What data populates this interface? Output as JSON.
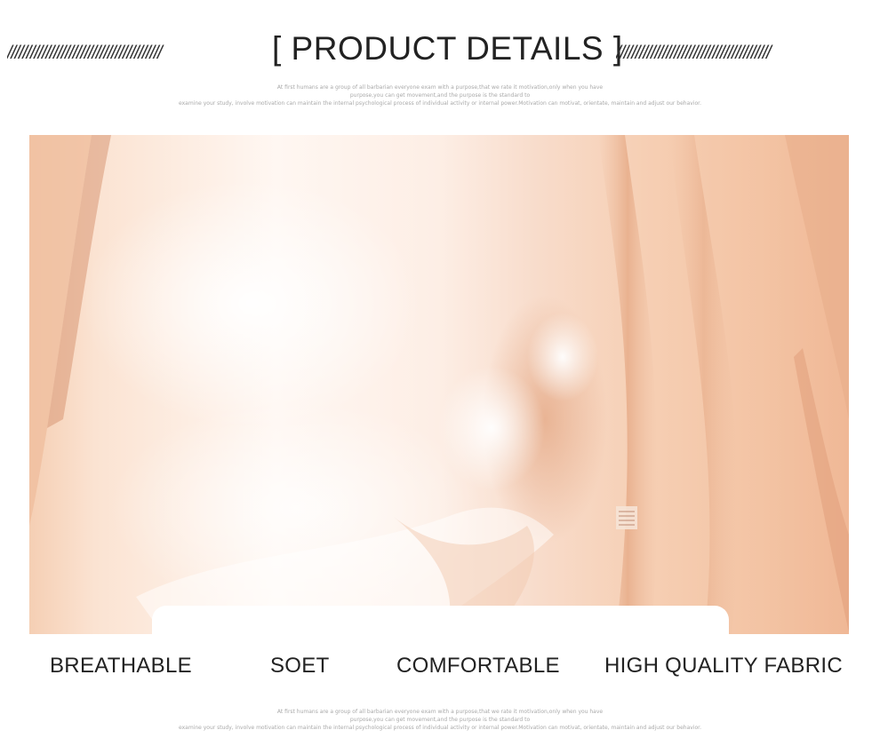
{
  "header": {
    "title": "[ PRODUCT DETAILS ]",
    "slashes_left": "////////////////////////////////////////",
    "slashes_right": "////////////////////////////////////////"
  },
  "intro_text": {
    "line1": "At first humans are a group of all barbarian everyone exam with a purpose,that  we rate it motivation,only when you have",
    "line2": "purpose,you can get movement,and the purpose is the standard to",
    "line3": "examine your study, involve motivation can maintain the internal psychological process of individual activity or internal power.Motivation can motivat, orientate, maintain and adjust our behavior."
  },
  "features": [
    "BREATHABLE",
    "SOET",
    "COMFORTABLE",
    "HIGH QUALITY FABRIC"
  ],
  "footer_text": {
    "line1": "At first humans are a group of all barbarian everyone exam with a purpose,that  we rate it motivation,only when you have",
    "line2": "purpose,you can get movement,and the purpose is the standard to",
    "line3": "examine your study, involve motivation can maintain the internal psychological process of individual activity or internal power.Motivation can motivat, orientate, maintain and adjust our behavior."
  },
  "colors": {
    "fabric_light": "#fdf1ea",
    "fabric_mid": "#f7d9c5",
    "fabric_dark": "#e9b18e",
    "text": "#222222"
  }
}
